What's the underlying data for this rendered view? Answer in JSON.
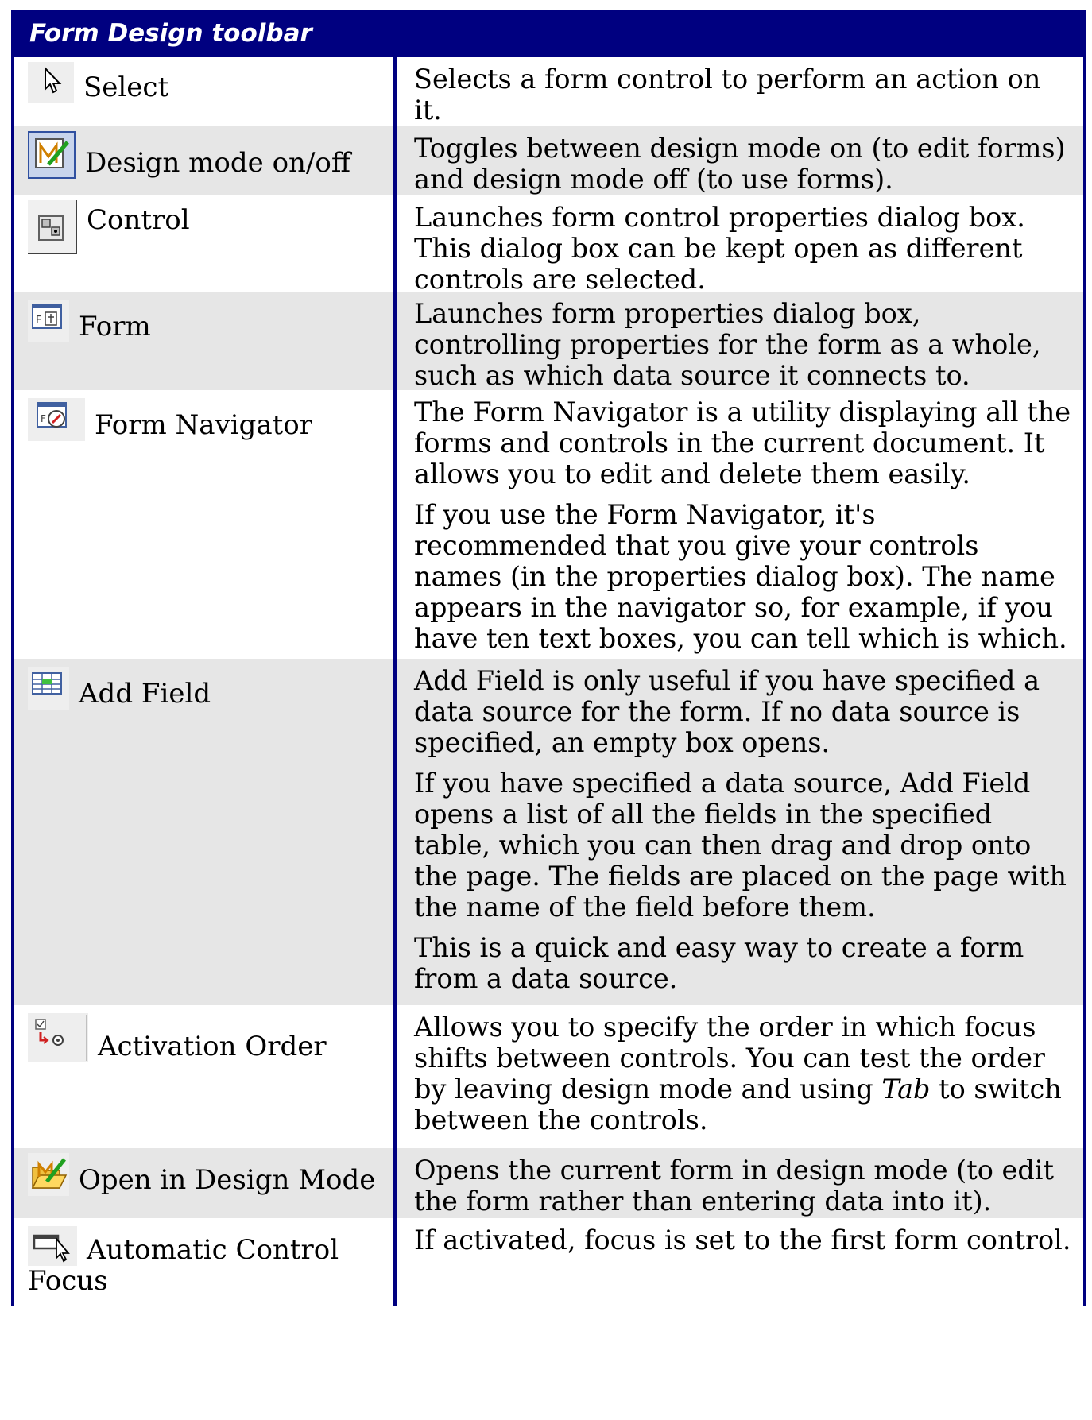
{
  "table": {
    "title": "Form Design toolbar",
    "rows": [
      {
        "label": "Select",
        "icon": "select-pointer-icon",
        "desc": [
          "Selects a form control to perform an action on it."
        ]
      },
      {
        "label": "Design mode on/off",
        "icon": "design-mode-icon",
        "desc": [
          "Toggles between design mode on (to edit forms) and design mode off (to use forms)."
        ]
      },
      {
        "label": "Control",
        "icon": "control-properties-icon",
        "desc": [
          "Launches form control properties dialog box. This dialog box can be kept open as different controls are selected."
        ]
      },
      {
        "label": "Form",
        "icon": "form-properties-icon",
        "desc": [
          "Launches form properties dialog box, controlling properties for the form as a whole, such as which data source it connects to."
        ]
      },
      {
        "label": "Form Navigator",
        "icon": "form-navigator-icon",
        "desc": [
          "The Form Navigator is a utility displaying all the forms and controls in the current document.  It allows you to edit and delete them easily.",
          "If you use the Form Navigator, it's recommended that you give your controls names (in the properties dialog box). The name appears in the navigator so, for example, if you have ten text boxes, you can tell which is which."
        ]
      },
      {
        "label": "Add Field",
        "icon": "add-field-icon",
        "desc": [
          "Add Field is only useful if you have specified a data source for the form. If no data source is specified, an empty box opens.",
          "If you have specified a data source, Add Field opens a list of all the fields in the specified table, which you can then drag and drop onto the page. The fields are placed on the page with the name of the field before them.",
          "This is a quick and easy way to create a form from a data source."
        ]
      },
      {
        "label": "Activation Order",
        "icon": "activation-order-icon",
        "desc_parts": {
          "before": "Allows you to specify the order in which focus shifts between controls. You can test the order by leaving design mode and using ",
          "italic": "Tab",
          "after": " to switch between the controls."
        }
      },
      {
        "label": "Open in Design Mode",
        "icon": "open-design-mode-icon",
        "desc": [
          "Opens the current form in design mode (to edit the form rather than entering data into it)."
        ]
      },
      {
        "label": "Automatic Control Focus",
        "icon": "automatic-control-focus-icon",
        "desc": [
          "If activated, focus is set to the first form control."
        ]
      }
    ]
  }
}
